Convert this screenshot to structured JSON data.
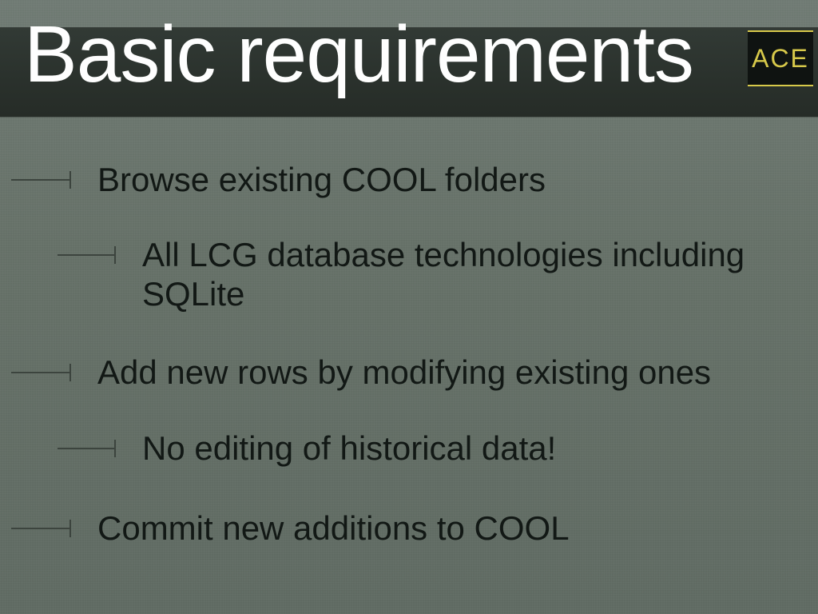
{
  "title": "Basic requirements",
  "badge": "ACE",
  "bullets": {
    "b1": "Browse existing COOL folders",
    "b1a": "All LCG database technologies including SQLite",
    "b2": "Add new rows by modifying existing ones",
    "b2a": "No editing of historical data!",
    "b3": "Commit new additions to COOL"
  }
}
